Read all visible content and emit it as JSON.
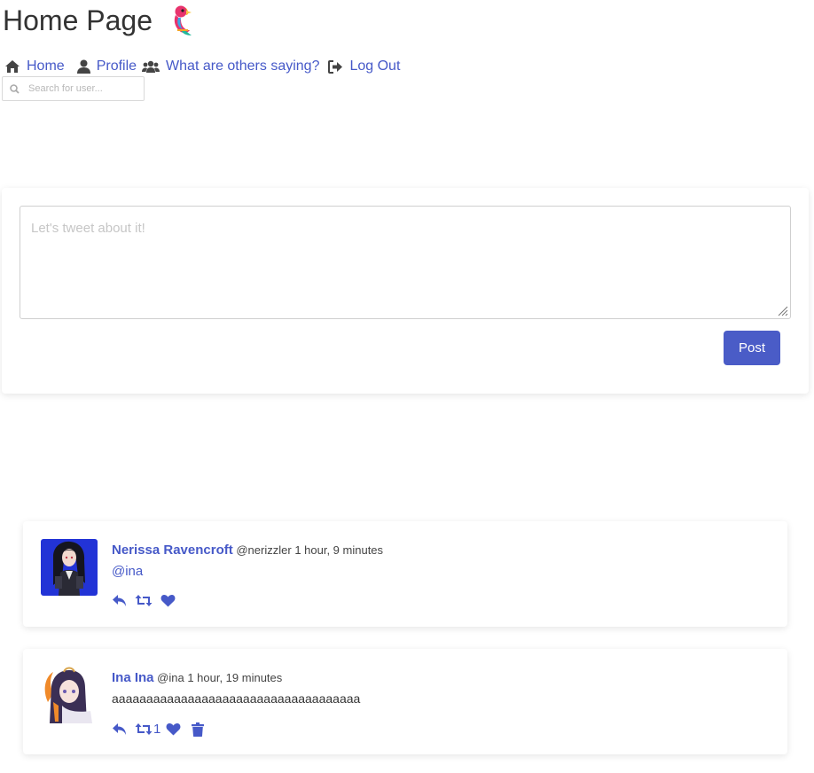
{
  "header": {
    "title": "Home Page"
  },
  "nav": {
    "items": [
      {
        "icon": "home-icon",
        "label": "Home"
      },
      {
        "icon": "user-icon",
        "label": "Profile"
      },
      {
        "icon": "users-icon",
        "label": "What are others saying?"
      },
      {
        "icon": "sign-out-icon",
        "label": "Log Out"
      }
    ]
  },
  "search": {
    "placeholder": "Search for user..."
  },
  "compose": {
    "placeholder": "Let's tweet about it!",
    "value": "",
    "post_label": "Post"
  },
  "feed": {
    "tweets": [
      {
        "name": "Nerissa Ravencroft",
        "handle": "@nerizzler",
        "time": "1 hour, 9 minutes",
        "text": "@ina",
        "retweet_count": "",
        "has_delete": false
      },
      {
        "name": "Ina Ina",
        "handle": "@ina",
        "time": "1 hour, 19 minutes",
        "text": "aaaaaaaaaaaaaaaaaaaaaaaaaaaaaaaaaaaa",
        "retweet_count": "1",
        "has_delete": true
      }
    ]
  },
  "colors": {
    "accent": "#4a5cc7",
    "link": "#4659c8",
    "text": "#333333"
  }
}
